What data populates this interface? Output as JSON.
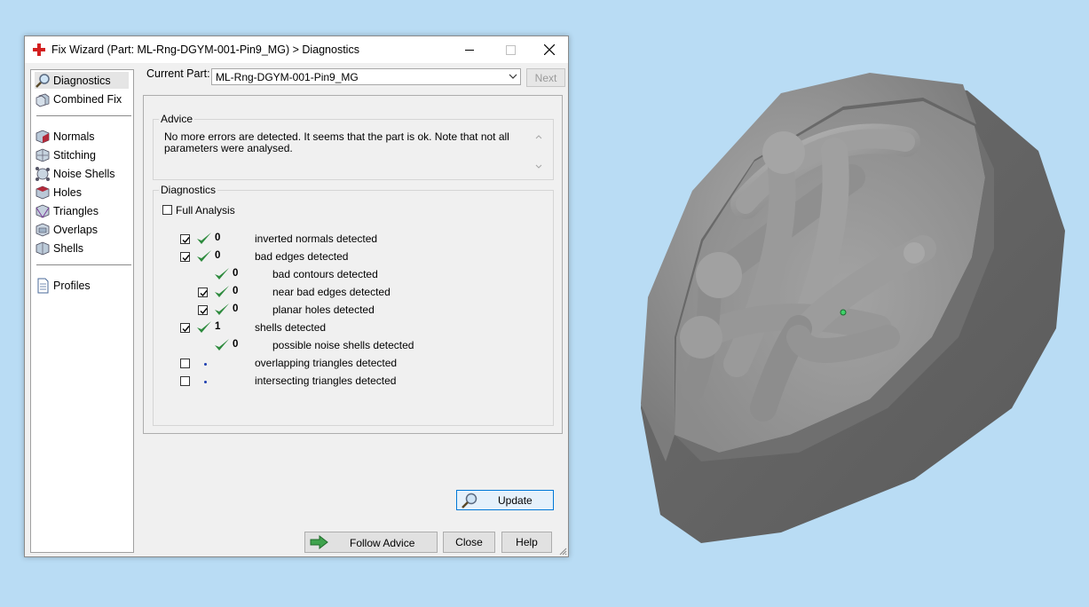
{
  "window": {
    "title": "Fix Wizard (Part: ML-Rng-DGYM-001-Pin9_MG) > Diagnostics"
  },
  "sidebar": {
    "items": [
      {
        "label": "Diagnostics",
        "icon": "magnifier-icon",
        "selected": true
      },
      {
        "label": "Combined Fix",
        "icon": "cube-stack-icon"
      },
      {
        "label": "Normals",
        "icon": "cube-red-icon"
      },
      {
        "label": "Stitching",
        "icon": "stitch-cube-icon"
      },
      {
        "label": "Noise Shells",
        "icon": "noise-shells-icon"
      },
      {
        "label": "Holes",
        "icon": "holes-cube-icon"
      },
      {
        "label": "Triangles",
        "icon": "triangles-cube-icon"
      },
      {
        "label": "Overlaps",
        "icon": "overlaps-cube-icon"
      },
      {
        "label": "Shells",
        "icon": "shells-cube-icon"
      },
      {
        "label": "Profiles",
        "icon": "document-icon"
      }
    ]
  },
  "current_part": {
    "label": "Current Part:",
    "value": "ML-Rng-DGYM-001-Pin9_MG"
  },
  "next_label": "Next",
  "advice": {
    "title": "Advice",
    "text": "No more errors are detected. It seems that the part is ok. Note that not all parameters were analysed."
  },
  "diagnostics": {
    "title": "Diagnostics",
    "full_analysis_label": "Full Analysis",
    "full_analysis_checked": false,
    "rows": [
      {
        "checkbox": true,
        "checked": true,
        "status": "ok",
        "count": "0",
        "label": "inverted normals detected",
        "indent": 0
      },
      {
        "checkbox": true,
        "checked": true,
        "status": "ok",
        "count": "0",
        "label": "bad edges detected",
        "indent": 0
      },
      {
        "checkbox": false,
        "checked": false,
        "status": "ok",
        "count": "0",
        "label": "bad contours detected",
        "indent": 1
      },
      {
        "checkbox": true,
        "checked": true,
        "status": "ok",
        "count": "0",
        "label": "near bad edges detected",
        "indent": 1
      },
      {
        "checkbox": true,
        "checked": true,
        "status": "ok",
        "count": "0",
        "label": "planar holes detected",
        "indent": 1
      },
      {
        "checkbox": true,
        "checked": true,
        "status": "ok",
        "count": "1",
        "label": "shells detected",
        "indent": 0
      },
      {
        "checkbox": false,
        "checked": false,
        "status": "ok",
        "count": "0",
        "label": "possible noise shells detected",
        "indent": 1
      },
      {
        "checkbox": true,
        "checked": false,
        "status": "dot",
        "count": "",
        "label": "overlapping triangles detected",
        "indent": 0
      },
      {
        "checkbox": true,
        "checked": false,
        "status": "dot",
        "count": "",
        "label": "intersecting triangles detected",
        "indent": 0
      }
    ],
    "update_label": "Update"
  },
  "buttons": {
    "follow_advice": "Follow Advice",
    "close": "Close",
    "help": "Help"
  },
  "colors": {
    "desktop": "#b9dcf4",
    "check_green": "#2e8b3e",
    "update_border": "#0078d7",
    "model_gray": "#8a8a8a"
  }
}
